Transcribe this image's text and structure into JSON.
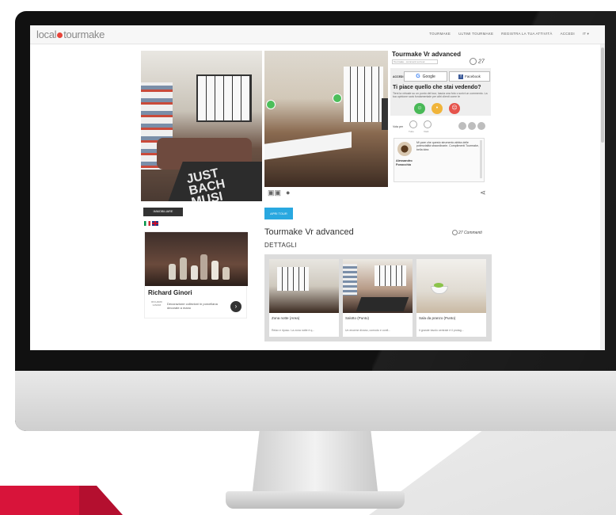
{
  "site": {
    "logo_left": "local",
    "logo_right": "tourmake",
    "nav": [
      "TOURMAKE",
      "ULTIMI TOURMAKE",
      "REGISTRA LA TUA ATTIVITÀ",
      "ACCEDI",
      "IT ▾"
    ]
  },
  "left_column": {
    "rug_text": "JUST\nBACH\nMUSI\nAMUS",
    "button_label": "IMMOBILIARE",
    "ad": {
      "title": "Richard Ginori",
      "text": "Decorazione collezioni in porcellana decorate a mano",
      "logo_text": "RICHARD GINORI"
    }
  },
  "panel": {
    "title": "Tourmake Vr advanced",
    "subtitle": "Tourmake - commenti sul tour",
    "count": "27",
    "login_label": "ACCEDI CON",
    "google_label": "Google",
    "facebook_label": "Facebook",
    "like_title": "Ti piace quello che stai vedendo?",
    "like_desc": "Tieni la virtuale su un punto del tour, lascia una foto o scrivi un commento. La tua opinione sarà fondamentale per altri clienti come te",
    "rating_label": "Vota per",
    "rating_caps": [
      "Tutto",
      "Visiti"
    ],
    "comment": {
      "text": "Mi pare che questo strumento abbia delle potenzialità straordinarie. Complimenti Tourmake, bella idea",
      "author": "Alessandro Fonocchio"
    }
  },
  "main": {
    "open_tour_label": "APRI TOUR",
    "tour_title": "Tourmake Vr advanced",
    "comments": "27 Commenti",
    "details_heading": "DETTAGLI",
    "gallery": [
      {
        "title": "Zona notte (Area)",
        "desc": "Relax e riposo. La zona notte è q..."
      },
      {
        "title": "Salotto (Punto)",
        "desc": "Un enorme divano, comodo e confi..."
      },
      {
        "title": "Sala da pranzo (Punto)",
        "desc": "Il grande tavolo centrale è il protag..."
      }
    ]
  },
  "colors": {
    "accent_blue": "#29a8e0",
    "happy": "#49b957",
    "neutral": "#f0b43a",
    "sad": "#e5534b",
    "brand_red": "#d8143a"
  },
  "icons": [
    "vr-headset-icon",
    "settings-icon",
    "share-icon",
    "comment-icon",
    "google-icon",
    "facebook-icon",
    "arrow-right-icon"
  ]
}
